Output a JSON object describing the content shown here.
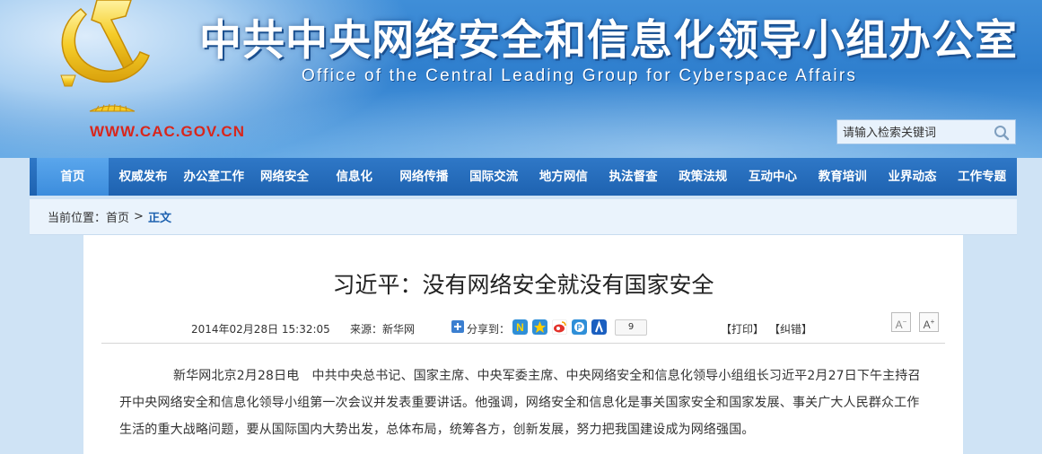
{
  "header": {
    "title": "中共中央网络安全和信息化领导小组办公室",
    "subtitle": "Office of the Central Leading Group for Cyberspace Affairs",
    "url": "WWW.CAC.GOV.CN",
    "emblem_icon": "party-emblem-icon"
  },
  "search": {
    "placeholder": "请输入检索关键词",
    "button_icon": "search-icon"
  },
  "nav": {
    "items": [
      {
        "label": "首页",
        "active": true
      },
      {
        "label": "权威发布"
      },
      {
        "label": "办公室工作"
      },
      {
        "label": "网络安全"
      },
      {
        "label": "信息化"
      },
      {
        "label": "网络传播"
      },
      {
        "label": "国际交流"
      },
      {
        "label": "地方网信"
      },
      {
        "label": "执法督查"
      },
      {
        "label": "政策法规"
      },
      {
        "label": "互动中心"
      },
      {
        "label": "教育培训"
      },
      {
        "label": "业界动态"
      },
      {
        "label": "工作专题"
      }
    ]
  },
  "breadcrumb": {
    "prefix": "当前位置：",
    "home": "首页",
    "separator": ">",
    "current": "正文"
  },
  "article": {
    "title": "习近平：没有网络安全就没有国家安全",
    "date": "2014年02月28日 15:32:05",
    "source": "来源：新华网",
    "share_label": "分享到：",
    "share_count": "9",
    "share_icons": [
      "sina-weibo-icon",
      "qzone-icon",
      "tencent-weibo-icon",
      "renren-icon",
      "baidu-icon"
    ],
    "print": "【打印】",
    "correct": "【纠错】",
    "font_smaller": "A",
    "font_larger": "A",
    "body": "新华网北京2月28日电　中共中央总书记、国家主席、中央军委主席、中央网络安全和信息化领导小组组长习近平2月27日下午主持召开中央网络安全和信息化领导小组第一次会议并发表重要讲话。他强调，网络安全和信息化是事关国家安全和国家发展、事关广大人民群众工作生活的重大战略问题，要从国际国内大势出发，总体布局，统筹各方，创新发展，努力把我国建设成为网络强国。"
  },
  "colors": {
    "header_blue": "#2f7fce",
    "nav_blue": "#1e62b0",
    "nav_active": "#4a98e4",
    "url_red": "#d8261c",
    "emblem_gold": "#f2c21a"
  }
}
